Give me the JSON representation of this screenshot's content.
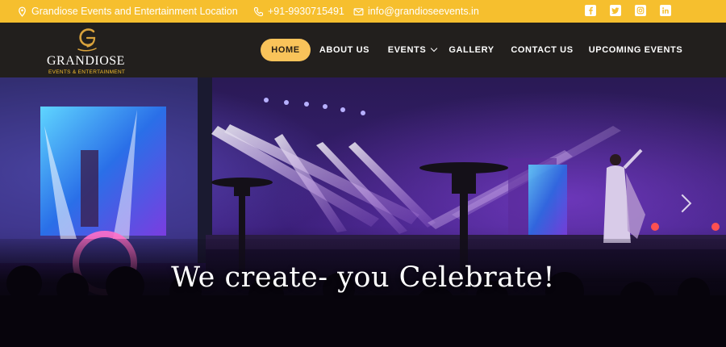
{
  "topbar": {
    "location": "Grandiose Events and Entertainment Location",
    "phone": "+91-9930715491",
    "email": "info@grandioseevents.in",
    "social": [
      "facebook-icon",
      "twitter-icon",
      "instagram-icon",
      "linkedin-icon"
    ]
  },
  "logo": {
    "name": "GRANDIOSE",
    "tagline": "EVENTS & ENTERTAINMENT"
  },
  "nav": {
    "items": [
      {
        "label": "HOME",
        "active": true
      },
      {
        "label": "ABOUT US"
      },
      {
        "label": "EVENTS",
        "has_dropdown": true
      },
      {
        "label": "GALLERY"
      },
      {
        "label": "CONTACT US"
      },
      {
        "label": "UPCOMING EVENTS"
      }
    ]
  },
  "hero": {
    "headline": "We create- you Celebrate!"
  },
  "colors": {
    "accent": "#f6bf2e",
    "nav_bg": "#221f1d",
    "active_pill": "#f9c35a"
  }
}
